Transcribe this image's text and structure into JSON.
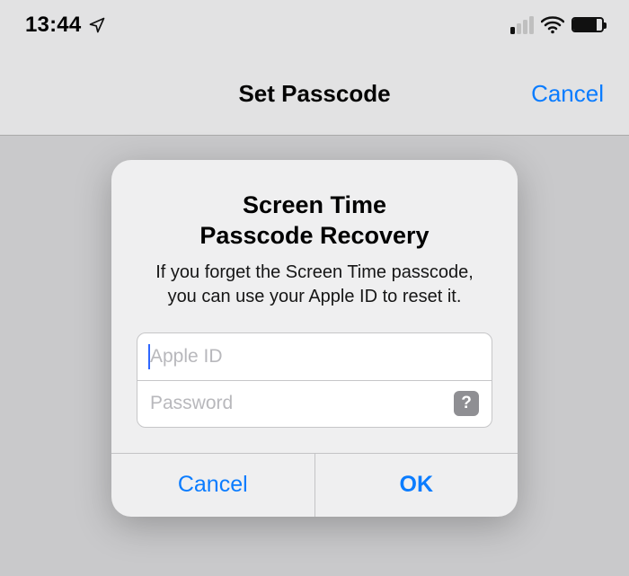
{
  "status_bar": {
    "time": "13:44"
  },
  "nav": {
    "title": "Set Passcode",
    "cancel": "Cancel"
  },
  "dialog": {
    "title_line1": "Screen Time",
    "title_line2": "Passcode Recovery",
    "message": "If you forget the Screen Time passcode, you can use your Apple ID to reset it.",
    "apple_id_placeholder": "Apple ID",
    "apple_id_value": "",
    "password_placeholder": "Password",
    "password_value": "",
    "help_symbol": "?",
    "cancel": "Cancel",
    "ok": "OK"
  }
}
